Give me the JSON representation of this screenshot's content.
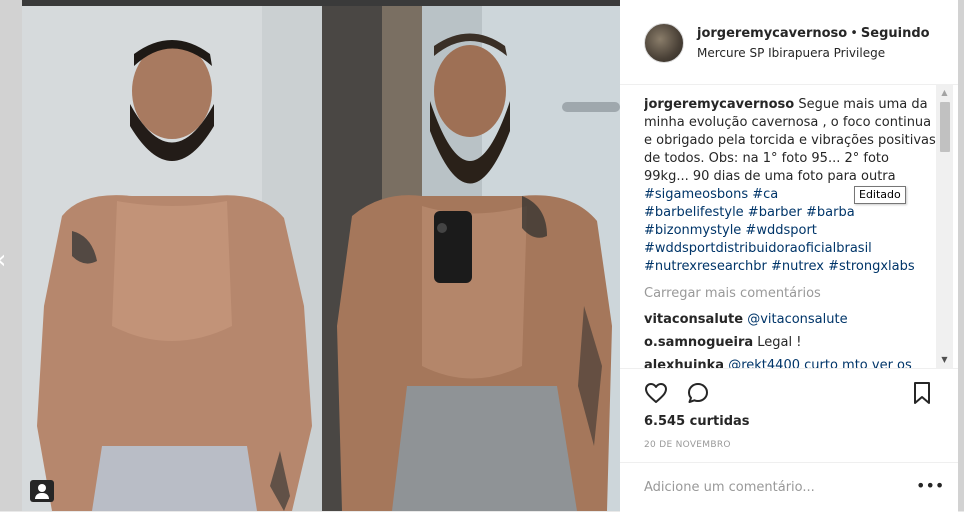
{
  "header": {
    "username": "jorgeremycavernoso",
    "separator": "•",
    "follow_status": "Seguindo",
    "location": "Mercure SP Ibirapuera Privilege"
  },
  "caption": {
    "username": "jorgeremycavernoso",
    "text": "Segue mais uma da minha evolução cavernosa , o foco continua e obrigado pela torcida e vibrações positivas de todos. Obs: na 1° foto 95... 2° foto 99kg... 90 dias de uma foto para outra",
    "hashtags_line1": "#sigameosbons",
    "hashtag_cut": "#ca",
    "hashtags_line2": "#barbelifestyle #barber #barba",
    "hashtags_line3": "#bizonmystyle #wddsport",
    "hashtags_line4": "#wddsportdistribuidoraoficialbrasil",
    "hashtags_line5": "#nutrexresearchbr #nutrex #strongxlabs"
  },
  "tooltip": "Editado",
  "load_more": "Carregar mais comentários",
  "comments": [
    {
      "user": "vitaconsalute",
      "text": "@vitaconsalute",
      "is_mention": true
    },
    {
      "user": "o.samnogueira",
      "text": "Legal !",
      "is_mention": false
    },
    {
      "user": "alexhuinka",
      "text": "@rekt4400 curto mto ver os",
      "is_mention": true
    }
  ],
  "actions": {
    "icons": [
      "heart-icon",
      "comment-icon",
      "bookmark-icon"
    ],
    "likes": "6.545 curtidas",
    "date": "20 DE NOVEMBRO"
  },
  "comment_box": {
    "placeholder": "Adicione um comentário...",
    "more_label": "•••"
  },
  "nav": {
    "prev_glyph": "‹"
  },
  "colors": {
    "hashtag": "#003569",
    "muted": "#999999",
    "text": "#262626",
    "border": "#efefef"
  }
}
